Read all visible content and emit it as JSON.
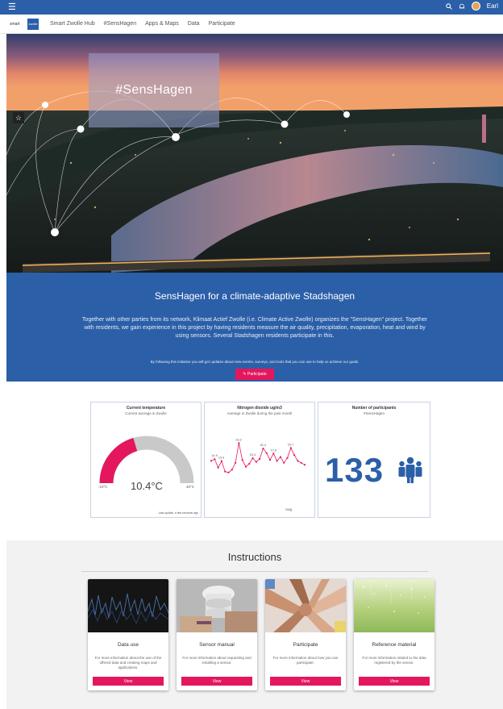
{
  "topbar": {
    "menu_icon": "hamburger-menu-icon",
    "user_name": "Earl"
  },
  "nav": {
    "logo_text": "smart",
    "logo_box_text": "zwolle",
    "links": [
      "Smart Zwolle Hub",
      "#SensHagen",
      "Apps & Maps",
      "Data",
      "Participate"
    ]
  },
  "hero": {
    "title": "#SensHagen"
  },
  "info": {
    "heading": "SensHagen for a climate-adaptive Stadshagen",
    "lead": "Together with other parties from its network, Klimaat Actief Zwolle (i.e. Climate Active Zwolle) organizes the \"SensHagen\" project. Together with residents, we gain experience in this project by having residents measure the air quality, precipitation, evaporation, heat and wind by using sensors. Several Stadshagen residents participate in this.",
    "follow_note": "By following this initiative you will get updates about new events, surveys, and tools that you can use to help us achieve our goals.",
    "participate_button": "Participate"
  },
  "widgets": {
    "temperature": {
      "title": "Current temperature",
      "subtitle": "Current average in Zwolle",
      "value": "10.4°C",
      "min": "-10°C",
      "max": "40°C",
      "fraction": 0.408,
      "last_update": "Last update: a few seconds ago"
    },
    "nitrogen": {
      "title": "Nitrogen dioxide ug/m3",
      "subtitle": "Average in Zwolle during the past month",
      "xlabel": "Aug"
    },
    "participants": {
      "title": "Number of participants",
      "subtitle": "#SensHagen",
      "value": "133"
    }
  },
  "chart_data": {
    "type": "line",
    "title": "Nitrogen dioxide ug/m3",
    "xlabel": "Aug",
    "ylabel": "",
    "labels": [
      "14.9",
      "13.9",
      "23.2",
      "15.4",
      "20.4",
      "17.8",
      "20.7"
    ],
    "values": [
      14.0,
      14.9,
      10.5,
      13.9,
      8.5,
      8.0,
      9.5,
      13.0,
      23.2,
      14.5,
      11.0,
      12.5,
      15.4,
      13.5,
      15.0,
      20.4,
      18.0,
      14.5,
      17.8,
      14.0,
      16.0,
      13.0,
      15.5,
      20.7,
      17.0,
      14.0,
      13.0,
      12.0
    ],
    "ylim": [
      0,
      30
    ],
    "grid": false,
    "legend": "none",
    "color": "#e4175e"
  },
  "instructions": {
    "title": "Instructions",
    "cards": [
      {
        "title": "Data use",
        "description": "For more information about the use of the offered data and creating maps and applications.",
        "button": "View"
      },
      {
        "title": "Sensor manual",
        "description": "For more information about requesting and installing a sensor.",
        "button": "View"
      },
      {
        "title": "Participate",
        "description": "For more information about how you can participate.",
        "button": "View"
      },
      {
        "title": "Reference material",
        "description": "For more information related to the data registered by the sensor.",
        "button": "View"
      }
    ]
  },
  "colors": {
    "brand_blue": "#2b5fa8",
    "accent_pink": "#e4175e"
  }
}
